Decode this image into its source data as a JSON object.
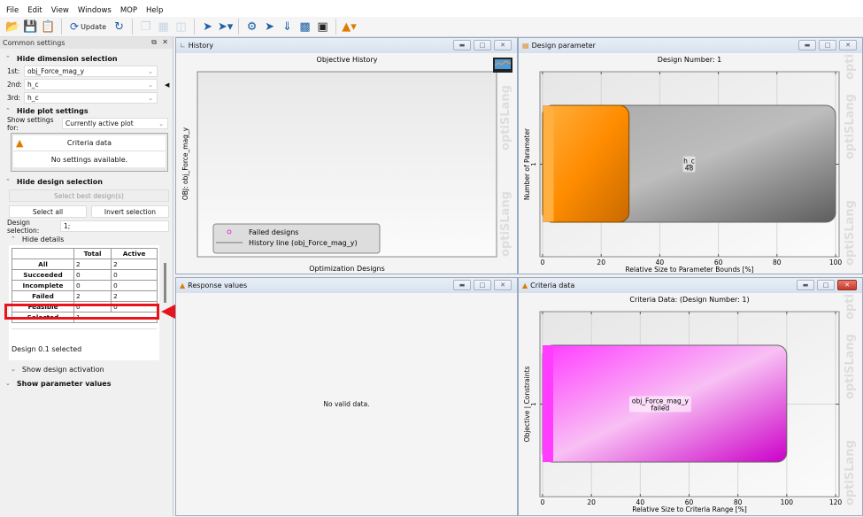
{
  "menu": [
    "File",
    "Edit",
    "View",
    "Windows",
    "MOP",
    "Help"
  ],
  "toolbar": {
    "update_label": "Update"
  },
  "left": {
    "title": "Common settings",
    "dim_section": "Hide dimension selection",
    "dims": [
      {
        "label": "1st:",
        "value": "obj_Force_mag_y"
      },
      {
        "label": "2nd:",
        "value": "h_c"
      },
      {
        "label": "3rd:",
        "value": "h_c"
      }
    ],
    "plot_section": "Hide plot settings",
    "show_settings_label": "Show settings for:",
    "show_settings_value": "Currently active plot",
    "plot_box_title": "Criteria data",
    "plot_box_msg": "No settings available.",
    "design_section": "Hide design selection",
    "select_best": "Select best design(s)",
    "select_all": "Select all",
    "invert": "Invert selection",
    "design_sel_label": "Design selection:",
    "design_sel_value": "1;",
    "details_section": "Hide details",
    "table": {
      "headers": [
        "",
        "Total",
        "Active"
      ],
      "rows": [
        [
          "All",
          "2",
          "2"
        ],
        [
          "Succeeded",
          "0",
          "0"
        ],
        [
          "Incomplete",
          "0",
          "0"
        ],
        [
          "Failed",
          "2",
          "2"
        ],
        [
          "Feasible",
          "0",
          "0"
        ],
        [
          "Selected",
          "1",
          ""
        ]
      ]
    },
    "status": "Design 0.1 selected",
    "activation": "Show design activation",
    "param_values": "Show parameter values"
  },
  "windows": {
    "history": {
      "title": "History",
      "plot_title": "Objective History",
      "ylabel": "OBJ: obj_Force_mag_y",
      "xlabel": "Optimization Designs",
      "legend": [
        "Failed designs",
        "History line (obj_Force_mag_y)"
      ]
    },
    "design": {
      "title": "Design parameter"
    },
    "response": {
      "title": "Response values",
      "msg": "No valid data."
    },
    "criteria": {
      "title": "Criteria data"
    }
  },
  "watermark": "optiSLang",
  "chart_data": [
    {
      "type": "bar",
      "id": "design",
      "title": "Design Number: 1",
      "xlabel": "Relative Size to Parameter Bounds [%]",
      "ylabel": "Number of Parameter",
      "xlim": [
        0,
        100
      ],
      "xticks": [
        0,
        20,
        40,
        60,
        80,
        100
      ],
      "yticks": [
        "1"
      ],
      "bars": [
        {
          "name": "h_c",
          "range": 100,
          "value": 29.5,
          "label1": "h_c",
          "label2": "48",
          "colors": [
            "#ffb040",
            "#ff8c00",
            "#c86a00"
          ],
          "bg": [
            "#a8a8a8",
            "#bdbdbd",
            "#5e5e5e"
          ]
        }
      ]
    },
    {
      "type": "bar",
      "id": "criteria",
      "title": "Criteria Data: (Design Number: 1)",
      "xlabel": "Relative Size to Criteria Range [%]",
      "ylabel": "Objective | Constraints",
      "xlim": [
        0,
        120
      ],
      "xticks": [
        0,
        20,
        40,
        60,
        80,
        100,
        120
      ],
      "yticks": [
        "1"
      ],
      "bars": [
        {
          "name": "obj_Force_mag_y",
          "range": 100,
          "value": 0,
          "label1": "obj_Force_mag_y",
          "label2": "failed",
          "bg": [
            "#ff3cff",
            "#f8c0f4",
            "#cc00c8"
          ]
        }
      ]
    }
  ]
}
